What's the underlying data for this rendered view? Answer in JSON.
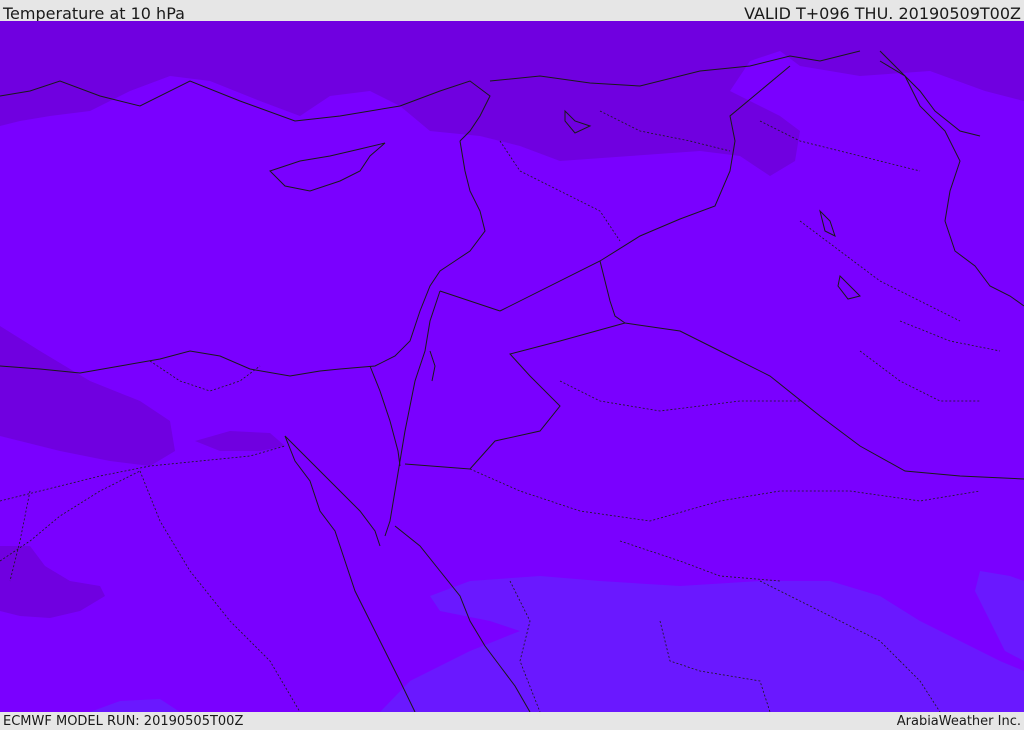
{
  "header": {
    "title": "Temperature at 10 hPa",
    "valid": "VALID T+096 THU. 20190509T00Z"
  },
  "footer": {
    "model_run": "ECMWF MODEL RUN: 20190505T00Z",
    "credit": "ArabiaWeather Inc."
  },
  "map": {
    "field": "temperature",
    "level": "10 hPa",
    "colors": {
      "base": "#7a00ff",
      "colder": "#7000e0",
      "warmer": "#6a18ff",
      "coastline": "#1a1a1a",
      "borders": "#1a1a1a"
    }
  }
}
